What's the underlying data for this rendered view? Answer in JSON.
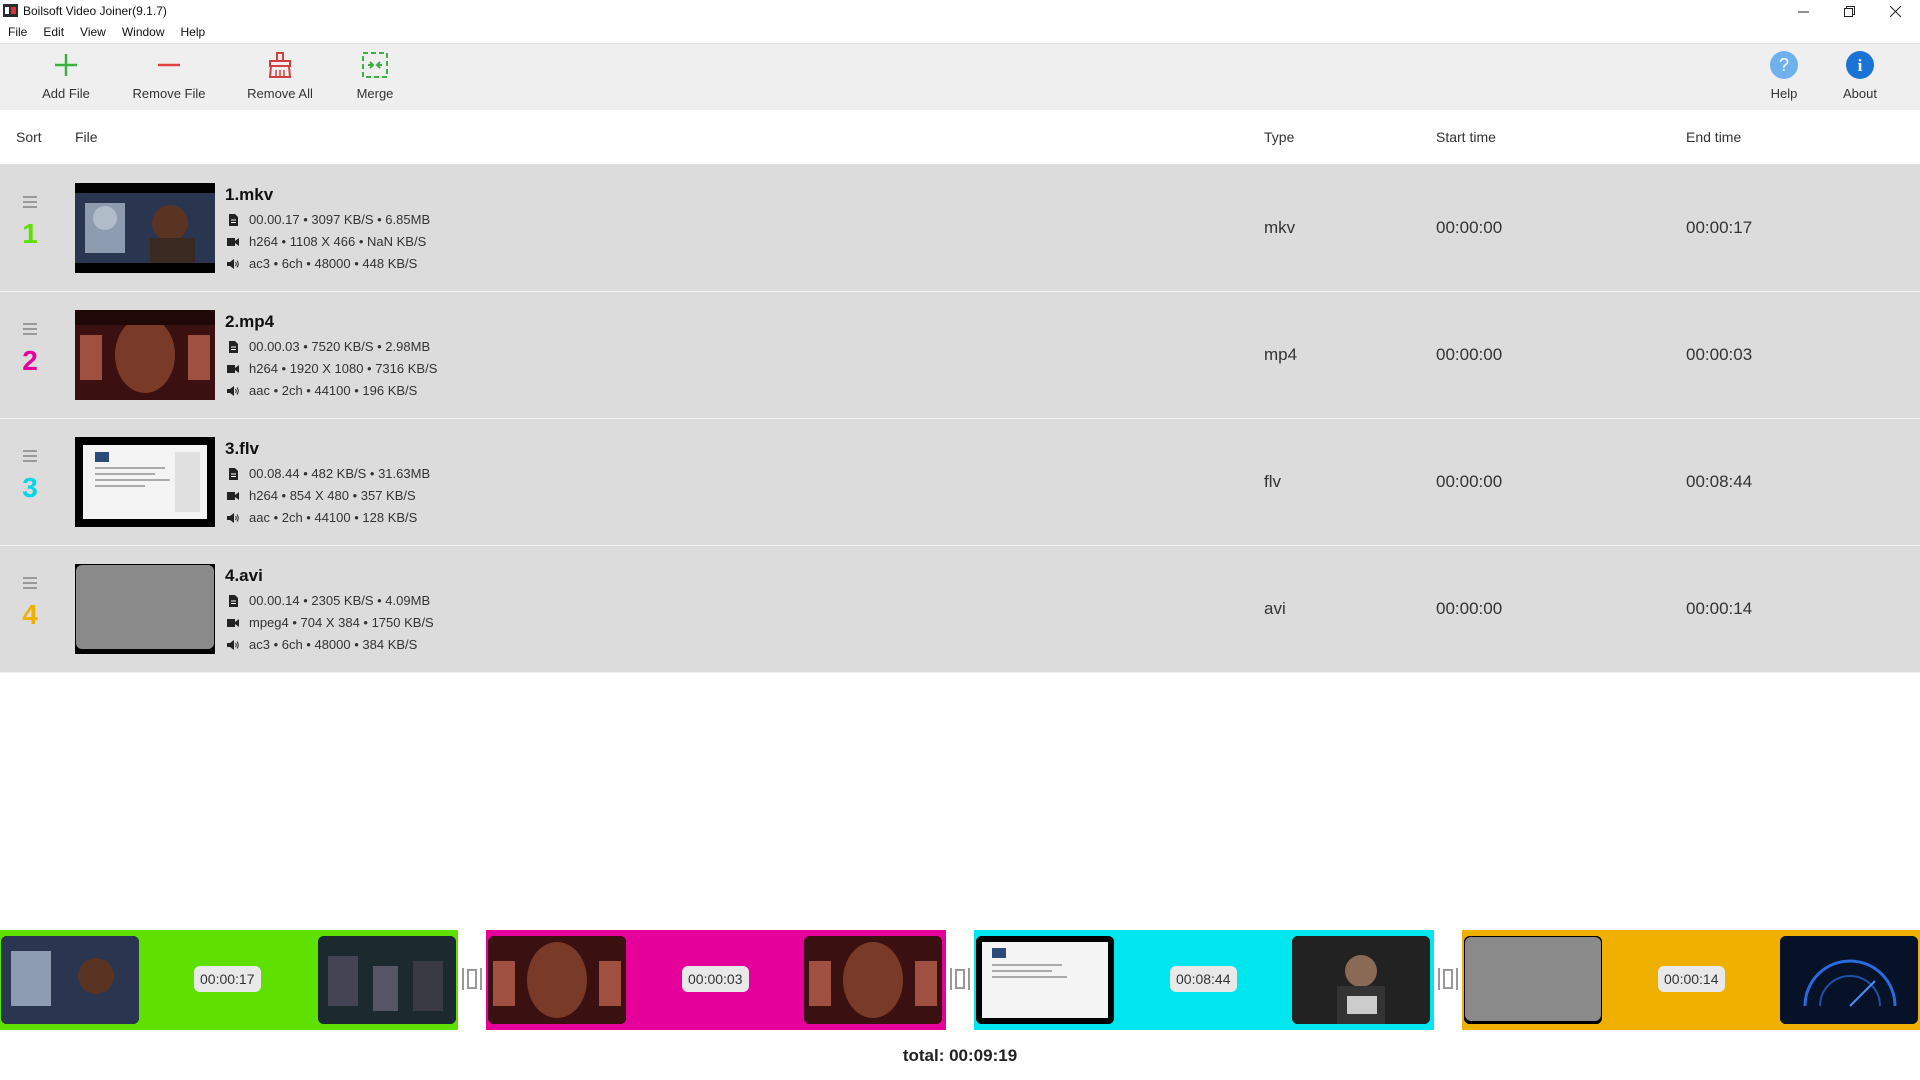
{
  "window": {
    "title": "Boilsoft Video Joiner(9.1.7)"
  },
  "menu": [
    "File",
    "Edit",
    "View",
    "Window",
    "Help"
  ],
  "toolbar": {
    "add_file": "Add File",
    "remove_file": "Remove File",
    "remove_all": "Remove All",
    "merge": "Merge",
    "help": "Help",
    "about": "About"
  },
  "header": {
    "sort": "Sort",
    "file": "File",
    "type": "Type",
    "start": "Start time",
    "end": "End time"
  },
  "files": [
    {
      "num": "1",
      "color": "#5ee000",
      "name": "1.mkv",
      "info": "00.00.17 • 3097 KB/S • 6.85MB",
      "video": "h264 • 1108 X 466 • NaN KB/S",
      "audio": "ac3 • 6ch • 48000 • 448 KB/S",
      "type": "mkv",
      "start": "00:00:00",
      "end": "00:00:17"
    },
    {
      "num": "2",
      "color": "#e6009b",
      "name": "2.mp4",
      "info": "00.00.03 • 7520 KB/S • 2.98MB",
      "video": "h264 • 1920 X 1080 • 7316 KB/S",
      "audio": "aac • 2ch • 44100 • 196 KB/S",
      "type": "mp4",
      "start": "00:00:00",
      "end": "00:00:03"
    },
    {
      "num": "3",
      "color": "#00d8e6",
      "name": "3.flv",
      "info": "00.08.44 • 482 KB/S • 31.63MB",
      "video": "h264 • 854 X 480 • 357 KB/S",
      "audio": "aac • 2ch • 44100 • 128 KB/S",
      "type": "flv",
      "start": "00:00:00",
      "end": "00:08:44"
    },
    {
      "num": "4",
      "color": "#f0b000",
      "name": "4.avi",
      "info": "00.00.14 • 2305 KB/S • 4.09MB",
      "video": "mpeg4 • 704 X 384 • 1750 KB/S",
      "audio": "ac3 • 6ch • 48000 • 384 KB/S",
      "type": "avi",
      "start": "00:00:00",
      "end": "00:00:14"
    }
  ],
  "timeline": {
    "segments": [
      {
        "color": "#5ee000",
        "duration": "00:00:17"
      },
      {
        "color": "#e6009b",
        "duration": "00:00:03"
      },
      {
        "color": "#00e6ee",
        "duration": "00:08:44"
      },
      {
        "color": "#f0b000",
        "duration": "00:00:14"
      }
    ]
  },
  "total": "total: 00:09:19"
}
